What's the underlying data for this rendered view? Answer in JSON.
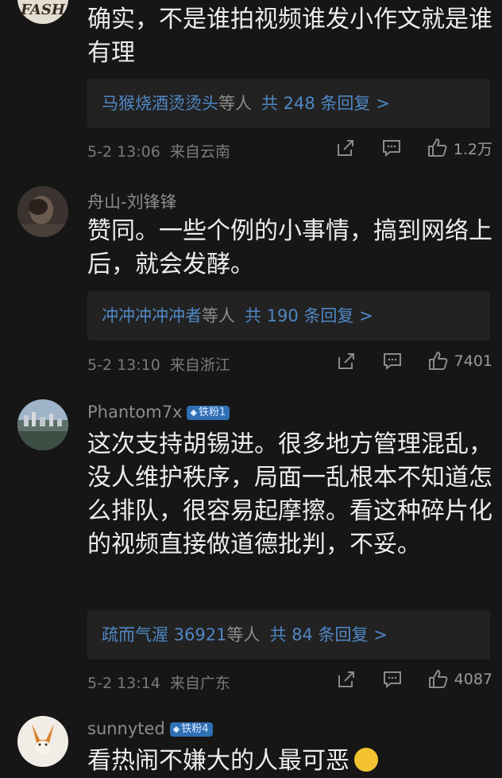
{
  "comments": [
    {
      "text": "确实，不是谁拍视频谁发小作文就是谁有理",
      "reply_names": "马猴烧酒烫烫头",
      "reply_mid": "等人",
      "reply_count": "共 248 条回复 >",
      "date": "5-2 13:06",
      "location": "来自云南",
      "likes": "1.2万",
      "avatar_text": "FASH"
    },
    {
      "username": "舟山-刘锋锋",
      "text": "赞同。一些个例的小事情，搞到网络上后，就会发酵。",
      "reply_names": "冲冲冲冲冲者",
      "reply_mid": "等人",
      "reply_count": "共 190 条回复 >",
      "date": "5-2 13:10",
      "location": "来自浙江",
      "likes": "7401"
    },
    {
      "username": "Phantom7x",
      "badge": "铁粉1",
      "text": "这次支持胡锡进。很多地方管理混乱，没人维护秩序，局面一乱根本不知道怎么排队，很容易起摩擦。看这种碎片化的视频直接做道德批判，不妥。",
      "reply_names": "疏而气渥 36921",
      "reply_mid": "等人",
      "reply_count": "共 84 条回复 >",
      "date": "5-2 13:14",
      "location": "来自广东",
      "likes": "4087"
    },
    {
      "username": "sunnyted",
      "badge": "铁粉4",
      "text": "看热闹不嫌大的人最可恶"
    }
  ],
  "icons": {
    "share": "share-icon",
    "comment": "comment-icon",
    "like": "thumbs-up-icon",
    "badge": "diamond-icon"
  }
}
